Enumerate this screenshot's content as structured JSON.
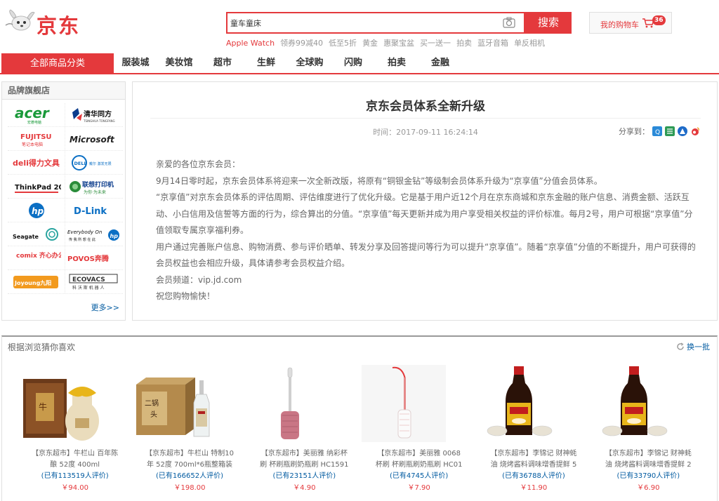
{
  "header": {
    "logo_text": "京东",
    "search_value": "童车童床",
    "search_button": "搜索",
    "hot_words": [
      {
        "text": "Apple Watch",
        "highlight": true
      },
      {
        "text": "领券99减40",
        "highlight": false
      },
      {
        "text": "低至5折",
        "highlight": false
      },
      {
        "text": "黄金",
        "highlight": false
      },
      {
        "text": "惠聚宝盆",
        "highlight": false
      },
      {
        "text": "买一送一",
        "highlight": false
      },
      {
        "text": "拍卖",
        "highlight": false
      },
      {
        "text": "蓝牙音箱",
        "highlight": false
      },
      {
        "text": "单反相机",
        "highlight": false
      }
    ],
    "cart_label": "我的购物车",
    "cart_count": "36"
  },
  "nav": {
    "all_categories": "全部商品分类",
    "items": [
      "服装城",
      "美妆馆",
      "超市",
      "生鲜",
      "全球购",
      "闪购",
      "拍卖",
      "金融"
    ]
  },
  "brands": {
    "title": "品牌旗舰店",
    "more": "更多>>",
    "logos": [
      [
        "acer",
        "清华同方"
      ],
      [
        "FUJITSU",
        "Microsoft"
      ],
      [
        "deli得力文具",
        "DELL"
      ],
      [
        "ThinkPad 20",
        "联想打印机"
      ],
      [
        "hp",
        "D-Link"
      ],
      [
        "Seagate",
        "Everybody On"
      ],
      [
        "comix 齐心办公",
        "POVOS奔腾"
      ],
      [
        "Joyoung九阳",
        "ECOVACS"
      ]
    ]
  },
  "article": {
    "title": "京东会员体系全新升级",
    "time": "时间：2017-09-11 16:24:14",
    "share_label": "分享到：",
    "paragraphs": [
      "亲爱的各位京东会员：",
      "9月14日零时起，京东会员体系将迎来一次全新改版，将原有“铜银金钻”等级制会员体系升级为“京享值”分值会员体系。",
      "“京享值”对京东会员体系的评估周期、评估维度进行了优化升级。它是基于用户近12个月在京东商城和京东金融的账户信息、消费金额、活跃互动、小白信用及信誓等方面的行为，综合算出的分值。“京享值”每天更新并成为用户享受相关权益的评价标准。每月2号，用户可根据“京享值”分值领取专属京享福利券。",
      "用户通过完善账户信息、购物消费、参与评价晒单、转发分享及回答提问等行为可以提升“京享值”。随着“京享值”分值的不断提升，用户可获得的会员权益也会相应升级，具体请参考会员权益介绍。",
      "会员频道：vip.jd.com",
      "祝您购物愉快！"
    ]
  },
  "recommend": {
    "title": "根据浏览猜你喜欢",
    "refresh": "换一批",
    "products": [
      {
        "name": "【京东超市】牛栏山 百年陈酿 52度 400ml",
        "comment": "(已有113519人评价)",
        "price": "￥94.00",
        "image": "baijiu-jar"
      },
      {
        "name": "【京东超市】牛栏山 特制10年 52度 700ml*6瓶整箱装",
        "comment": "(已有166652人评价)",
        "price": "￥198.00",
        "image": "erguotou-box"
      },
      {
        "name": "【京东超市】美丽雅 纳彩杯刷 杯刷瓶刷奶瓶刷 HC1591",
        "comment": "(已有23151人评价)",
        "price": "￥4.90",
        "image": "bottle-brush-pink"
      },
      {
        "name": "【京东超市】美丽雅 0068 杯刷 杯刷瓶刷奶瓶刷 HC01",
        "comment": "(已有4745人评价)",
        "price": "￥7.90",
        "image": "bottle-brush-white"
      },
      {
        "name": "【京东超市】李锦记 财神蚝油 烧烤酱料调味增香提鲜 5",
        "comment": "(已有36788人评价)",
        "price": "￥11.90",
        "image": "oyster-sauce"
      },
      {
        "name": "【京东超市】李锦记 财神蚝油 烧烤酱料调味增香提鲜 2",
        "comment": "(已有33790人评价)",
        "price": "￥6.90",
        "image": "oyster-sauce"
      }
    ]
  },
  "colors": {
    "brand_red": "#e4393c",
    "link_blue": "#005aa0"
  }
}
